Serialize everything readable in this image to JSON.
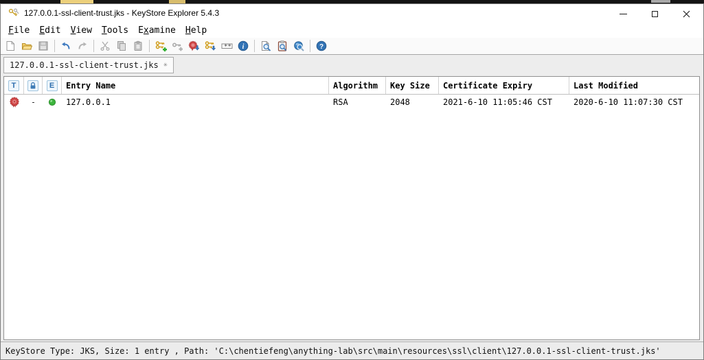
{
  "window": {
    "title": "127.0.0.1-ssl-client-trust.jks - KeyStore Explorer 5.4.3"
  },
  "menu": {
    "items": [
      {
        "pre": "",
        "mn": "F",
        "post": "ile"
      },
      {
        "pre": "",
        "mn": "E",
        "post": "dit"
      },
      {
        "pre": "",
        "mn": "V",
        "post": "iew"
      },
      {
        "pre": "",
        "mn": "T",
        "post": "ools"
      },
      {
        "pre": "E",
        "mn": "x",
        "post": "amine"
      },
      {
        "pre": "",
        "mn": "H",
        "post": "elp"
      }
    ]
  },
  "toolbar": {
    "buttons": [
      {
        "name": "new-keystore",
        "enabled": true
      },
      {
        "name": "open-keystore",
        "enabled": true
      },
      {
        "name": "save-keystore",
        "enabled": false
      },
      {
        "name": "undo",
        "enabled": true
      },
      {
        "name": "redo",
        "enabled": false
      },
      {
        "name": "cut",
        "enabled": false
      },
      {
        "name": "copy",
        "enabled": false
      },
      {
        "name": "paste",
        "enabled": false
      },
      {
        "name": "generate-key-pair",
        "enabled": true
      },
      {
        "name": "generate-secret-key",
        "enabled": false
      },
      {
        "name": "import-trusted-certificate",
        "enabled": true
      },
      {
        "name": "import-key-pair",
        "enabled": true
      },
      {
        "name": "set-password",
        "enabled": true
      },
      {
        "name": "properties",
        "enabled": true
      },
      {
        "name": "examine-file",
        "enabled": true
      },
      {
        "name": "examine-clipboard",
        "enabled": true
      },
      {
        "name": "examine-ssl",
        "enabled": true
      },
      {
        "name": "help",
        "enabled": true
      }
    ]
  },
  "tab": {
    "label": "127.0.0.1-ssl-client-trust.jks",
    "close_glyph": "✳"
  },
  "table": {
    "header": {
      "type_letter": "T",
      "expiry_letter": "E",
      "entry_name": "Entry Name",
      "algorithm": "Algorithm",
      "key_size": "Key Size",
      "certificate_expiry": "Certificate Expiry",
      "last_modified": "Last Modified"
    },
    "rows": [
      {
        "type": "trusted-certificate",
        "lock": "-",
        "status": "valid",
        "entry_name": "127.0.0.1",
        "algorithm": "RSA",
        "key_size": "2048",
        "certificate_expiry": "2021-6-10 11:05:46 CST",
        "last_modified": "2020-6-10 11:07:30 CST"
      }
    ]
  },
  "statusbar": {
    "text": "KeyStore Type: JKS, Size: 1 entry , Path: 'C:\\chentiefeng\\anything-lab\\src\\main\\resources\\ssl\\client\\127.0.0.1-ssl-client-trust.jks'"
  },
  "colors": {
    "accent_blue": "#3e7ac0",
    "key_gold": "#d19f1f",
    "cert_red": "#cf4646",
    "status_green": "#3cb43c"
  }
}
